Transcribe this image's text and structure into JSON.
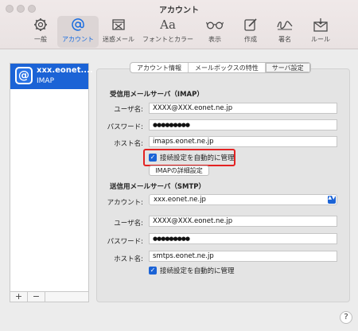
{
  "window": {
    "title": "アカウント"
  },
  "toolbar": {
    "items": [
      {
        "label": "一般",
        "icon": "gear-icon"
      },
      {
        "label": "アカウント",
        "icon": "at-sign-icon"
      },
      {
        "label": "迷惑メール",
        "icon": "junk-mail-icon"
      },
      {
        "label": "フォントとカラー",
        "icon": "font-icon",
        "glyph": "Aa"
      },
      {
        "label": "表示",
        "icon": "glasses-icon"
      },
      {
        "label": "作成",
        "icon": "compose-icon"
      },
      {
        "label": "署名",
        "icon": "signature-icon"
      },
      {
        "label": "ルール",
        "icon": "rules-icon"
      }
    ]
  },
  "sidebar": {
    "account": {
      "name": "xxx.eonet....",
      "type": "IMAP",
      "icon_glyph": "@"
    },
    "add_label": "+",
    "remove_label": "−"
  },
  "tabs": [
    {
      "label": "アカウント情報"
    },
    {
      "label": "メールボックスの特性"
    },
    {
      "label": "サーバ設定"
    }
  ],
  "incoming": {
    "heading": "受信用メールサーバ（IMAP）",
    "username_label": "ユーザ名:",
    "username": "XXXX@XXX.eonet.ne.jp",
    "password_label": "パスワード:",
    "password": "●●●●●●●●●",
    "host_label": "ホスト名:",
    "host": "imaps.eonet.ne.jp",
    "auto_manage_label": "接続設定を自動的に管理",
    "check_glyph": "✓",
    "details_button": "IMAPの詳細設定"
  },
  "outgoing": {
    "heading": "送信用メールサーバ（SMTP）",
    "account_label": "アカウント:",
    "account_value": "xxx.eonet.ne.jp",
    "select_arrows": "▲▼",
    "username_label": "ユーザ名:",
    "username": "XXXX@XXX.eonet.ne.jp",
    "password_label": "パスワード:",
    "password": "●●●●●●●●●",
    "host_label": "ホスト名:",
    "host": "smtps.eonet.ne.jp",
    "auto_manage_label": "接続設定を自動的に管理",
    "check_glyph": "✓"
  },
  "help_label": "?",
  "colors": {
    "accent": "#1b63d6",
    "highlight": "#e32222"
  }
}
